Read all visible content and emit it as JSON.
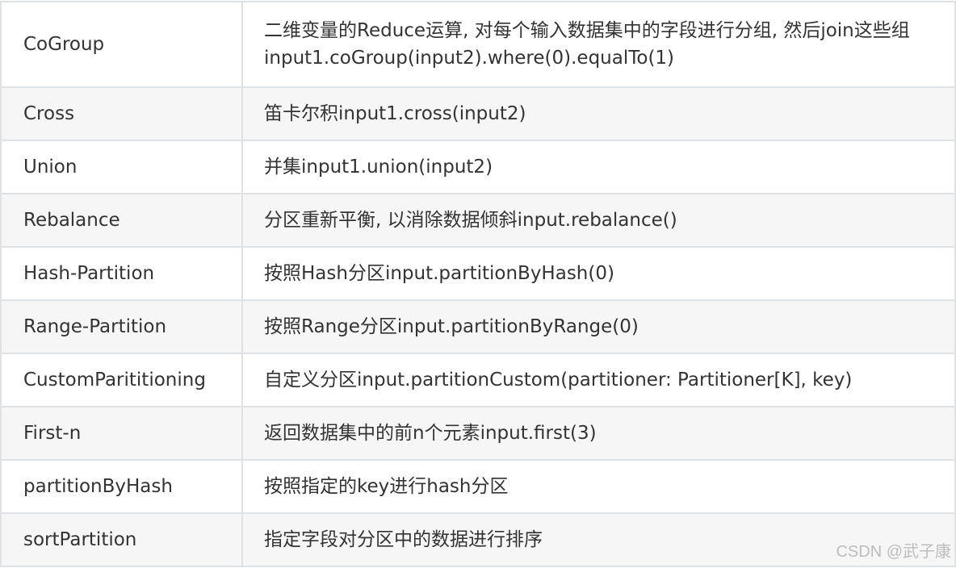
{
  "rows": [
    {
      "name": "CoGroup",
      "desc": "二维变量的Reduce运算, 对每个输入数据集中的字段进行分组, 然后join这些组input1.coGroup(input2).where(0).equalTo(1)"
    },
    {
      "name": "Cross",
      "desc": "笛卡尔积input1.cross(input2)"
    },
    {
      "name": "Union",
      "desc": "并集input1.union(input2)"
    },
    {
      "name": "Rebalance",
      "desc": "分区重新平衡, 以消除数据倾斜input.rebalance()"
    },
    {
      "name": "Hash-Partition",
      "desc": "按照Hash分区input.partitionByHash(0)"
    },
    {
      "name": "Range-Partition",
      "desc": "按照Range分区input.partitionByRange(0)"
    },
    {
      "name": "CustomParititioning",
      "desc": "自定义分区input.partitionCustom(partitioner: Partitioner[K], key)"
    },
    {
      "name": "First-n",
      "desc": "返回数据集中的前n个元素input.first(3)"
    },
    {
      "name": "partitionByHash",
      "desc": "按照指定的key进行hash分区"
    },
    {
      "name": "sortPartition",
      "desc": "指定字段对分区中的数据进行排序"
    }
  ],
  "watermark": "CSDN @武子康"
}
